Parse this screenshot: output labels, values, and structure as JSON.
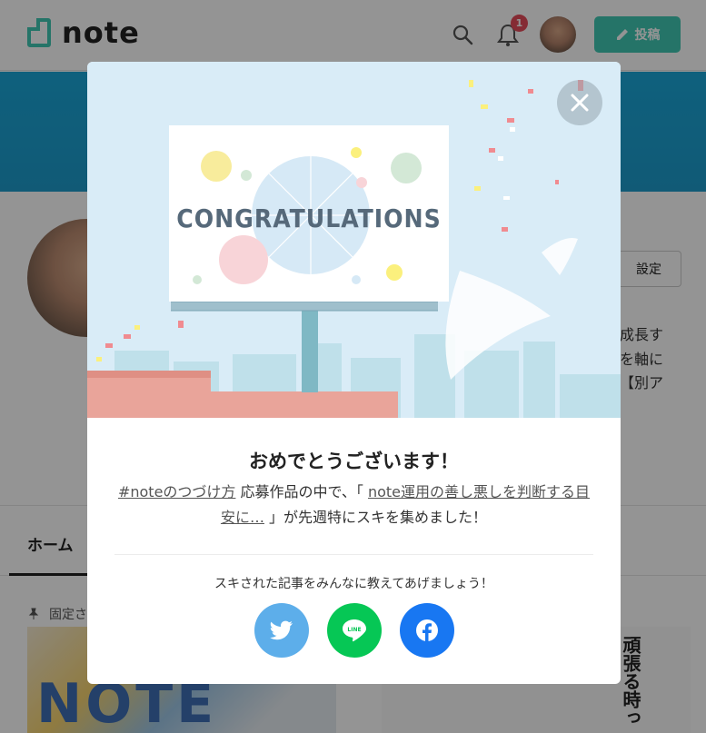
{
  "header": {
    "logo_text": "note",
    "notification_count": "1",
    "post_label": "投稿"
  },
  "profile": {
    "settings_label": "設定",
    "bio_lines": [
      "成長す",
      "を軸に",
      "【別ア"
    ]
  },
  "tabs": {
    "home_label": "ホーム",
    "pinned_label": "固定さ"
  },
  "cards": {
    "thumb1_text": "NOTE",
    "thumb2_text": "頑張る時っ"
  },
  "modal": {
    "banner_text": "CONGRATULATIONS",
    "title": "おめでとうございます！",
    "msg_link1": "#noteのつづけ方",
    "msg_part1": " 応募作品の中で、「 ",
    "msg_link2": "note運用の善し悪しを判断する目安に…",
    "msg_part2": " 」が先週特にスキを集めました！",
    "share_prompt": "スキされた記事をみんなに教えてあげましょう！",
    "line_label": "LINE"
  },
  "colors": {
    "brand": "#41c9b4",
    "twitter": "#5daeea",
    "line": "#06c755",
    "facebook": "#1877f2",
    "badge": "#e54a5a"
  },
  "icons": [
    "search-icon",
    "bell-icon",
    "pencil-icon",
    "close-icon",
    "pin-icon",
    "twitter-icon",
    "line-icon",
    "facebook-icon"
  ]
}
